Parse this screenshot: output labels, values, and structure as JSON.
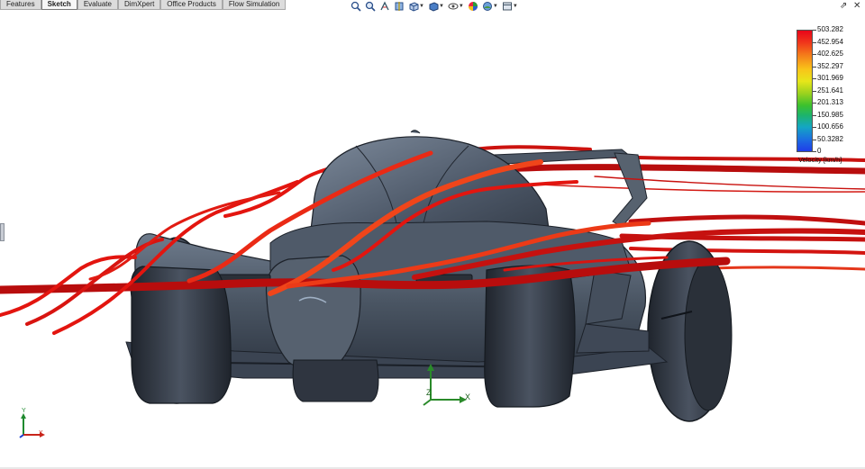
{
  "tabs": [
    {
      "label": "Features",
      "active": false
    },
    {
      "label": "Sketch",
      "active": true
    },
    {
      "label": "Evaluate",
      "active": false
    },
    {
      "label": "DimXpert",
      "active": false
    },
    {
      "label": "Office Products",
      "active": false
    },
    {
      "label": "Flow Simulation",
      "active": false
    }
  ],
  "view_toolbar": [
    "zoom-to-fit-icon",
    "zoom-to-area-icon",
    "previous-view-icon",
    "section-view-icon",
    "view-orientation-icon",
    "display-style-icon",
    "hide-show-items-icon",
    "edit-appearance-icon",
    "apply-scene-icon",
    "view-settings-icon"
  ],
  "window_controls": {
    "restore": "⇗",
    "close": "✕"
  },
  "legend": {
    "values": [
      "503.282",
      "452.954",
      "402.625",
      "352.297",
      "301.969",
      "251.641",
      "201.313",
      "150.985",
      "100.656",
      "50.3282",
      "0"
    ],
    "title": "Velocity [km/h]",
    "top_color": "#e8061a",
    "bottom_color": "#1f3ce9"
  },
  "triad": {
    "x": "X",
    "y": "Y",
    "z": "Z"
  },
  "colors": {
    "streamline_dark": "#b80d0d",
    "streamline": "#e3150f",
    "streamline_hot": "#f0451a",
    "car_body": "#4a5563",
    "car_highlight": "#8a96a6",
    "tire": "#2b3039"
  }
}
